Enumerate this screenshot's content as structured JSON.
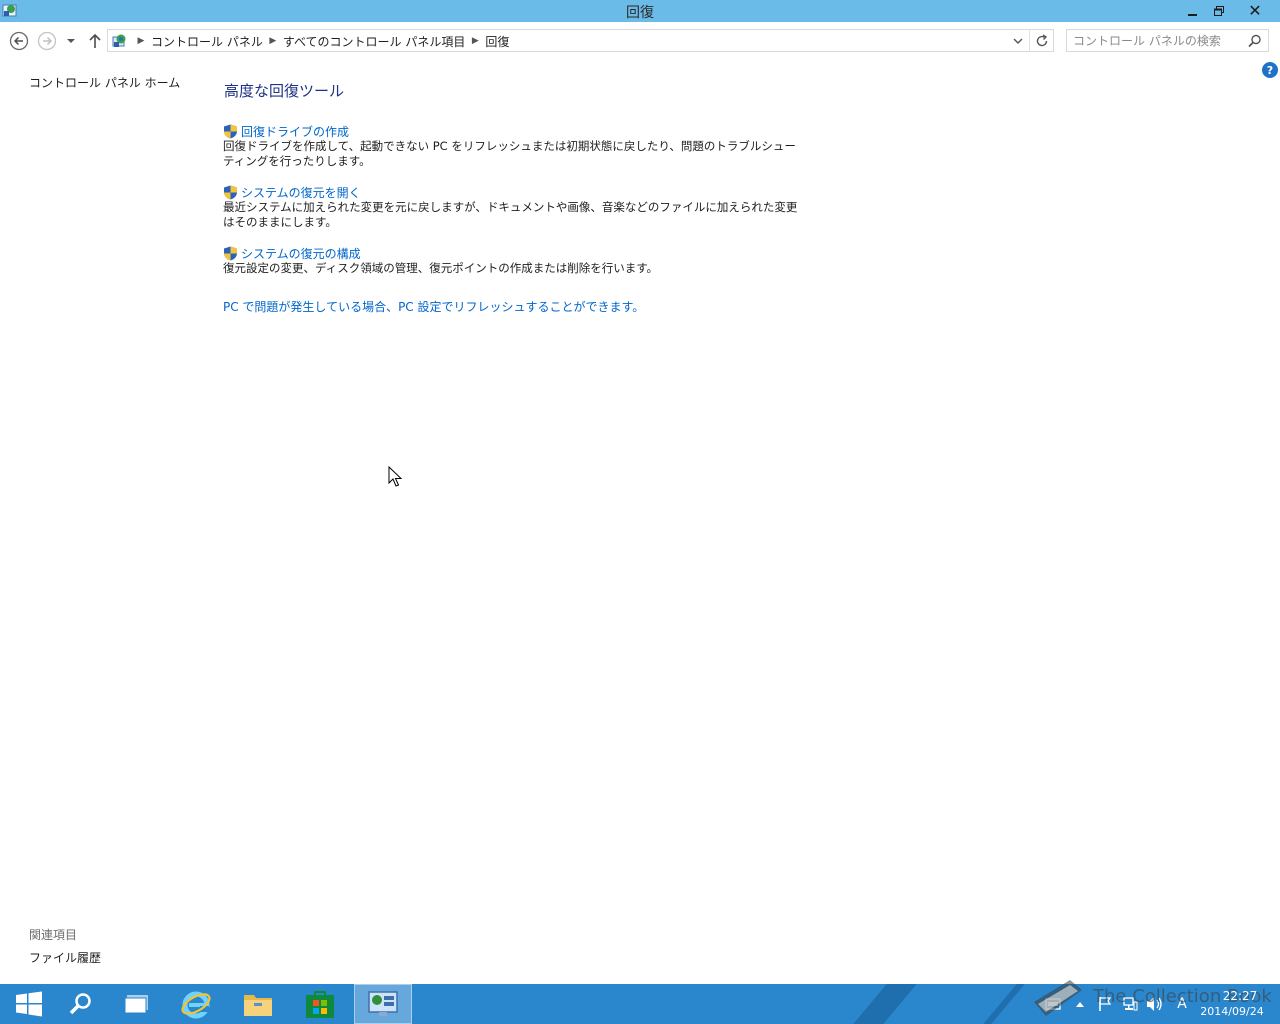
{
  "window": {
    "title": "回復",
    "minimize_glyph": "🗕",
    "maximize_glyph": "🗗",
    "close_glyph": "✕"
  },
  "address": {
    "breadcrumbs": [
      "コントロール パネル",
      "すべてのコントロール パネル項目",
      "回復"
    ]
  },
  "search": {
    "placeholder": "コントロール パネルの検索"
  },
  "left_pane": {
    "home_link": "コントロール パネル ホーム",
    "related_heading": "関連項目",
    "related_links": [
      "ファイル履歴"
    ]
  },
  "main": {
    "title": "高度な回復ツール",
    "tools": [
      {
        "link": "回復ドライブの作成",
        "description": "回復ドライブを作成して、起動できない PC をリフレッシュまたは初期状態に戻したり、問題のトラブルシューティングを行ったりします。"
      },
      {
        "link": "システムの復元を開く",
        "description": "最近システムに加えられた変更を元に戻しますが、ドキュメントや画像、音楽などのファイルに加えられた変更はそのままにします。"
      },
      {
        "link": "システムの復元の構成",
        "description": "復元設定の変更、ディスク領域の管理、復元ポイントの作成または削除を行います。"
      }
    ],
    "pc_settings_link": "PC で問題が発生している場合、PC 設定でリフレッシュすることができます。"
  },
  "help": {
    "glyph": "?"
  },
  "taskbar": {
    "colors": {
      "bar": "#2b87cd",
      "stripe": "#1f6fae"
    },
    "items": [
      "start-icon",
      "search-icon",
      "task-view-icon",
      "internet-explorer-icon",
      "file-explorer-icon",
      "store-icon",
      "control-panel-icon"
    ],
    "ime_indicator": "A",
    "clock_time": "22:27",
    "clock_date": "2014/09/24",
    "watermark": "The Collection Book"
  },
  "colors": {
    "titlebar": "#6bbbe8",
    "link": "#0066cc",
    "heading": "#1e3287"
  }
}
